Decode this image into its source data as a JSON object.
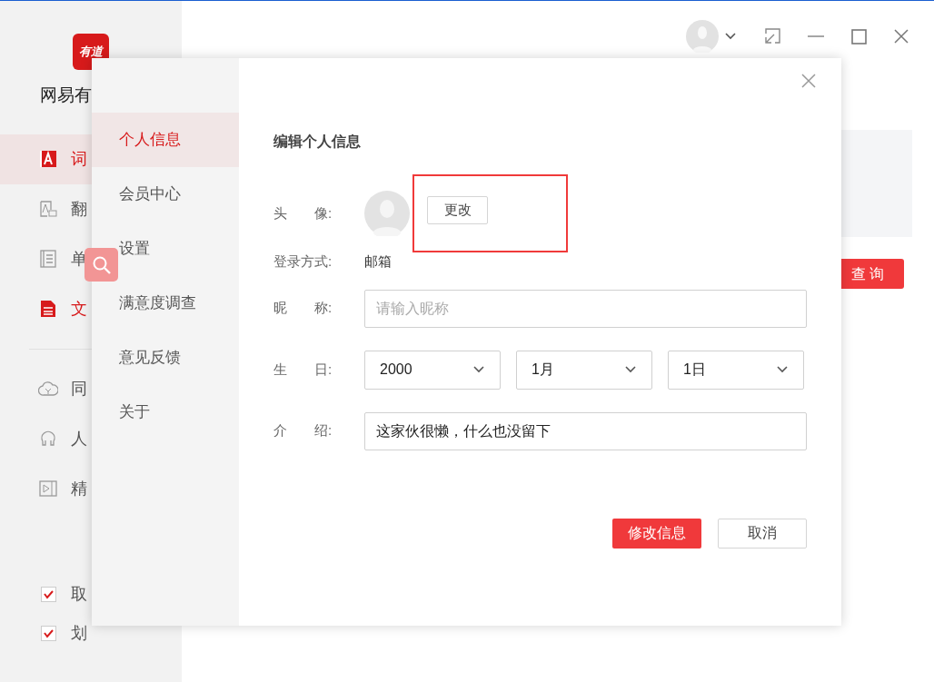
{
  "app": {
    "logo_text": "有道",
    "brand": "网易有",
    "nav": [
      {
        "label": "词",
        "kind": "dict",
        "selected": true
      },
      {
        "label": "翻",
        "kind": "translate",
        "selected": false
      },
      {
        "label": "单",
        "kind": "wordbook",
        "selected": false
      },
      {
        "label": "文",
        "kind": "doc",
        "selected": false
      }
    ],
    "nav_more": [
      {
        "label": "同",
        "kind": "cloud"
      },
      {
        "label": "人",
        "kind": "human"
      },
      {
        "label": "精",
        "kind": "video"
      }
    ],
    "options": [
      {
        "label": "取",
        "checked": true
      },
      {
        "label": "划",
        "checked": true
      }
    ],
    "query_button": "查 询"
  },
  "dialog": {
    "menu": [
      {
        "label": "个人信息",
        "selected": true
      },
      {
        "label": "会员中心",
        "selected": false
      },
      {
        "label": "设置",
        "selected": false
      },
      {
        "label": "满意度调查",
        "selected": false
      },
      {
        "label": "意见反馈",
        "selected": false
      },
      {
        "label": "关于",
        "selected": false
      }
    ],
    "title": "编辑个人信息",
    "avatar_label": "头　　像:",
    "change_button": "更改",
    "login_label": "登录方式:",
    "login_value": "邮箱",
    "nickname_label": "昵　　称:",
    "nickname": {
      "placeholder": "请输入昵称"
    },
    "birthday_label": "生　　日:",
    "birthday": [
      "2000",
      "1月",
      "1日"
    ],
    "intro_label": "介　　绍:",
    "intro": "这家伙很懒，什么也没留下",
    "submit": "修改信息",
    "cancel": "取消"
  }
}
